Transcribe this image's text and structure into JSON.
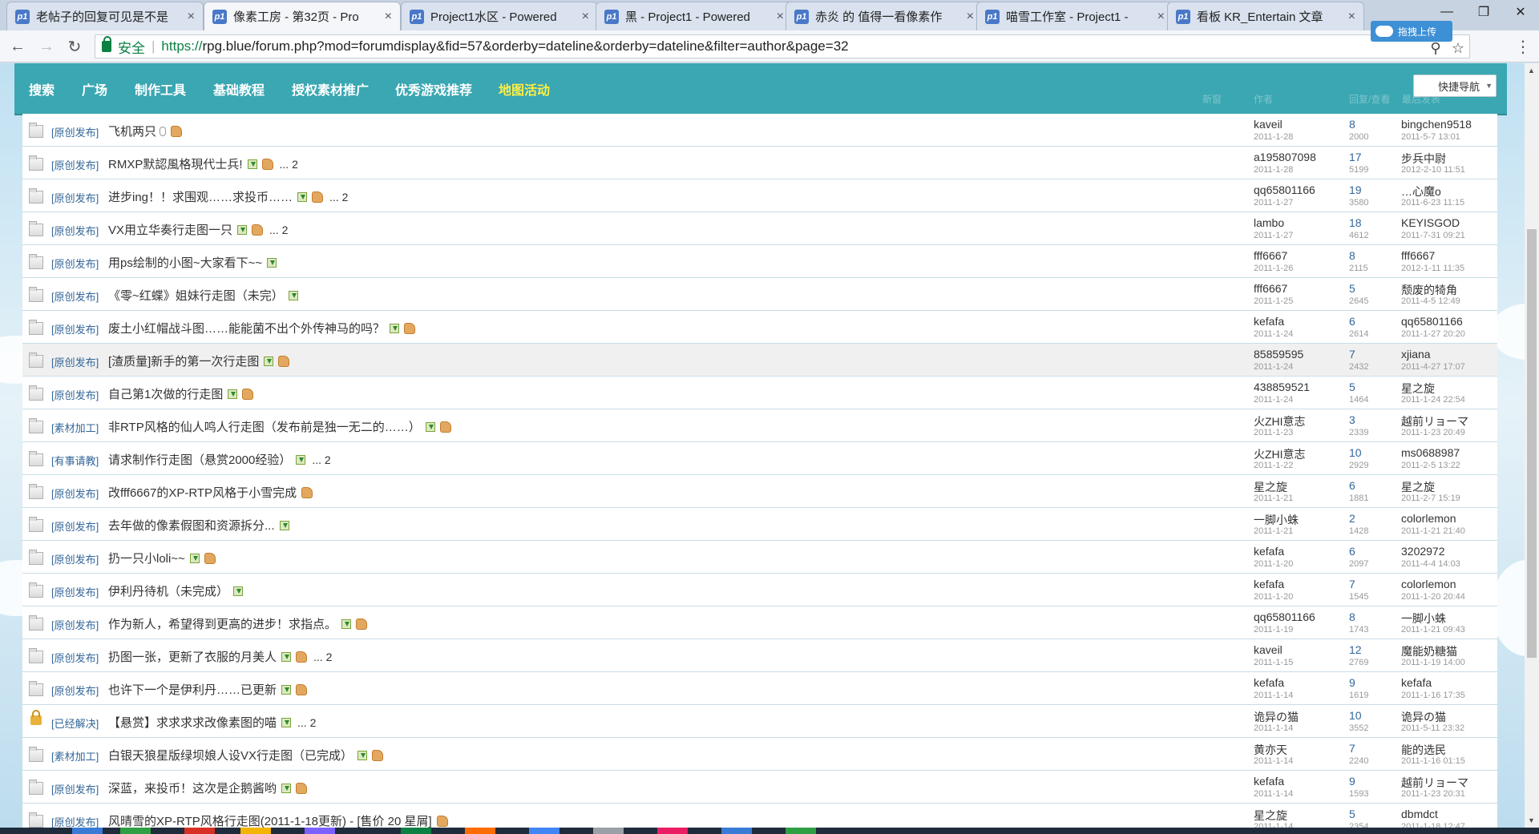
{
  "tabs": [
    {
      "title": "老帖子的回复可见是不是"
    },
    {
      "title": "像素工房 - 第32页 - Pro"
    },
    {
      "title": "Project1水区 - Powered"
    },
    {
      "title": "黑 - Project1 - Powered"
    },
    {
      "title": "赤炎 的 值得一看像素作"
    },
    {
      "title": "喵雪工作室 - Project1 -"
    },
    {
      "title": "看板 KR_Entertain 文章"
    }
  ],
  "favicon_text": "p1",
  "address": {
    "secure_label": "安全",
    "separator": "|",
    "url_scheme": "https://",
    "url_rest": "rpg.blue/forum.php?mod=forumdisplay&fid=57&orderby=dateline&orderby=dateline&filter=author&page=32"
  },
  "upload_chip": "拖拽上传",
  "nav": {
    "items": [
      "搜索",
      "广场",
      "制作工具",
      "基础教程",
      "授权素材推广",
      "优秀游戏推荐",
      "地图活动"
    ],
    "quick_nav": "快捷导航"
  },
  "header_ghost": {
    "new": "新窗",
    "author": "作者",
    "replies_views": "回复/查看",
    "last_post": "最后发表"
  },
  "threads": [
    {
      "cat": "[原创发布]",
      "title": "飞机两只",
      "clip": true,
      "attach": false,
      "thumb": true,
      "pages": "",
      "price": "",
      "author": "kaveil",
      "adate": "2011-1-28",
      "replies": "8",
      "views": "2000",
      "last_user": "bingchen9518",
      "last_date": "2011-5-7 13:01"
    },
    {
      "cat": "[原创发布]",
      "title": "RMXP默認風格現代士兵!",
      "attach": true,
      "thumb": true,
      "pages": "... 2",
      "price": "",
      "author": "a195807098",
      "adate": "2011-1-28",
      "replies": "17",
      "views": "5199",
      "last_user": "步兵中尉",
      "last_date": "2012-2-10 11:51"
    },
    {
      "cat": "[原创发布]",
      "title": "进步ing！！求围观……求投币……",
      "attach": true,
      "thumb": true,
      "pages": "... 2",
      "price": "",
      "author": "qq65801166",
      "adate": "2011-1-27",
      "replies": "19",
      "views": "3580",
      "last_user": "…心魔o",
      "last_date": "2011-6-23 11:15"
    },
    {
      "cat": "[原创发布]",
      "title": "VX用立华奏行走图一只",
      "attach": true,
      "thumb": true,
      "pages": "... 2",
      "price": "",
      "author": "lambo",
      "adate": "2011-1-27",
      "replies": "18",
      "views": "4612",
      "last_user": "KEYISGOD",
      "last_date": "2011-7-31 09:21"
    },
    {
      "cat": "[原创发布]",
      "title": "用ps绘制的小图~大家看下~~",
      "attach": true,
      "thumb": false,
      "pages": "",
      "price": "",
      "author": "fff6667",
      "adate": "2011-1-26",
      "replies": "8",
      "views": "2115",
      "last_user": "fff6667",
      "last_date": "2012-1-11 11:35"
    },
    {
      "cat": "[原创发布]",
      "title": "《零~红蝶》姐妹行走图（未完）",
      "attach": true,
      "thumb": false,
      "pages": "",
      "price": "",
      "author": "fff6667",
      "adate": "2011-1-25",
      "replies": "5",
      "views": "2645",
      "last_user": "颓废的犄角",
      "last_date": "2011-4-5 12:49"
    },
    {
      "cat": "[原创发布]",
      "title": "废土小红帽战斗图……能能菌不出个外传神马的吗？",
      "attach": true,
      "thumb": true,
      "pages": "",
      "price": "",
      "author": "kefafa",
      "adate": "2011-1-24",
      "replies": "6",
      "views": "2614",
      "last_user": "qq65801166",
      "last_date": "2011-1-27 20:20"
    },
    {
      "cat": "[原创发布]",
      "title": "[渣质量]新手的第一次行走图",
      "attach": true,
      "thumb": true,
      "pages": "",
      "price": "",
      "author": "85859595",
      "adate": "2011-1-24",
      "replies": "7",
      "views": "2432",
      "last_user": "xjiana",
      "last_date": "2011-4-27 17:07",
      "hover": true
    },
    {
      "cat": "[原创发布]",
      "title": "自己第1次做的行走图",
      "attach": true,
      "thumb": true,
      "pages": "",
      "price": "",
      "author": "438859521",
      "adate": "2011-1-24",
      "replies": "5",
      "views": "1464",
      "last_user": "星之旋",
      "last_date": "2011-1-24 22:54"
    },
    {
      "cat": "[素材加工]",
      "title": "非RTP风格的仙人鸣人行走图（发布前是独一无二的……）",
      "attach": true,
      "thumb": true,
      "pages": "",
      "price": "",
      "author": "火ZHI意志",
      "adate": "2011-1-23",
      "replies": "3",
      "views": "2339",
      "last_user": "越前リョーマ",
      "last_date": "2011-1-23 20:49"
    },
    {
      "cat": "[有事请教]",
      "title": "请求制作行走图（悬赏2000经验）",
      "attach": true,
      "thumb": false,
      "pages": "... 2",
      "price": "",
      "author": "火ZHI意志",
      "adate": "2011-1-22",
      "replies": "10",
      "views": "2929",
      "last_user": "ms0688987",
      "last_date": "2011-2-5 13:22"
    },
    {
      "cat": "[原创发布]",
      "title": "改fff6667的XP-RTP风格于小雪完成",
      "attach": false,
      "thumb": true,
      "pages": "",
      "price": "",
      "author": "星之旋",
      "adate": "2011-1-21",
      "replies": "6",
      "views": "1881",
      "last_user": "星之旋",
      "last_date": "2011-2-7 15:19"
    },
    {
      "cat": "[原创发布]",
      "title": "去年做的像素假图和资源拆分...",
      "attach": true,
      "thumb": false,
      "pages": "",
      "price": "",
      "author": "一脚小蛛",
      "adate": "2011-1-21",
      "replies": "2",
      "views": "1428",
      "last_user": "colorlemon",
      "last_date": "2011-1-21 21:40"
    },
    {
      "cat": "[原创发布]",
      "title": "扔一只小loli~~",
      "attach": true,
      "thumb": true,
      "pages": "",
      "price": "",
      "author": "kefafa",
      "adate": "2011-1-20",
      "replies": "6",
      "views": "2097",
      "last_user": "3202972",
      "last_date": "2011-4-4 14:03"
    },
    {
      "cat": "[原创发布]",
      "title": "伊利丹待机（未完成）",
      "attach": true,
      "thumb": false,
      "pages": "",
      "price": "",
      "author": "kefafa",
      "adate": "2011-1-20",
      "replies": "7",
      "views": "1545",
      "last_user": "colorlemon",
      "last_date": "2011-1-20 20:44"
    },
    {
      "cat": "[原创发布]",
      "title": "作为新人，希望得到更高的进步！求指点。",
      "attach": true,
      "thumb": true,
      "pages": "",
      "price": "",
      "author": "qq65801166",
      "adate": "2011-1-19",
      "replies": "8",
      "views": "1743",
      "last_user": "一脚小蛛",
      "last_date": "2011-1-21 09:43"
    },
    {
      "cat": "[原创发布]",
      "title": "扔图一张，更新了衣服的月美人",
      "attach": true,
      "thumb": true,
      "pages": "... 2",
      "price": "",
      "author": "kaveil",
      "adate": "2011-1-15",
      "replies": "12",
      "views": "2769",
      "last_user": "魔能奶糖猫",
      "last_date": "2011-1-19 14:00"
    },
    {
      "cat": "[原创发布]",
      "title": "也许下一个是伊利丹……已更新",
      "attach": true,
      "thumb": true,
      "pages": "",
      "price": "",
      "author": "kefafa",
      "adate": "2011-1-14",
      "replies": "9",
      "views": "1619",
      "last_user": "kefafa",
      "last_date": "2011-1-16 17:35"
    },
    {
      "cat": "[已经解决]",
      "title": "【悬赏】求求求求改像素图的喵",
      "attach": true,
      "thumb": false,
      "pages": "... 2",
      "price": "",
      "author": "诡异の猫",
      "adate": "2011-1-14",
      "replies": "10",
      "views": "3552",
      "last_user": "诡异の猫",
      "last_date": "2011-5-11 23:32",
      "locked": true
    },
    {
      "cat": "[素材加工]",
      "title": "白银天狼星版绿坝娘人设VX行走图（已完成）",
      "attach": true,
      "thumb": true,
      "pages": "",
      "price": "",
      "author": "黄亦天",
      "adate": "2011-1-14",
      "replies": "7",
      "views": "2240",
      "last_user": "能的选民",
      "last_date": "2011-1-16 01:15"
    },
    {
      "cat": "[原创发布]",
      "title": "深蓝，来投币！这次是企鹅酱哟",
      "attach": true,
      "thumb": true,
      "pages": "",
      "price": "",
      "author": "kefafa",
      "adate": "2011-1-14",
      "replies": "9",
      "views": "1593",
      "last_user": "越前リョーマ",
      "last_date": "2011-1-23 20:31"
    },
    {
      "cat": "[原创发布]",
      "title": "风晴雪的XP-RTP风格行走图(2011-1-18更新) - [售价 20 星屑]",
      "attach": false,
      "thumb": true,
      "pages": "",
      "price": "",
      "author": "星之旋",
      "adate": "2011-1-14",
      "replies": "5",
      "views": "2354",
      "last_user": "dbmdct",
      "last_date": "2011-1-18 12:47"
    }
  ]
}
